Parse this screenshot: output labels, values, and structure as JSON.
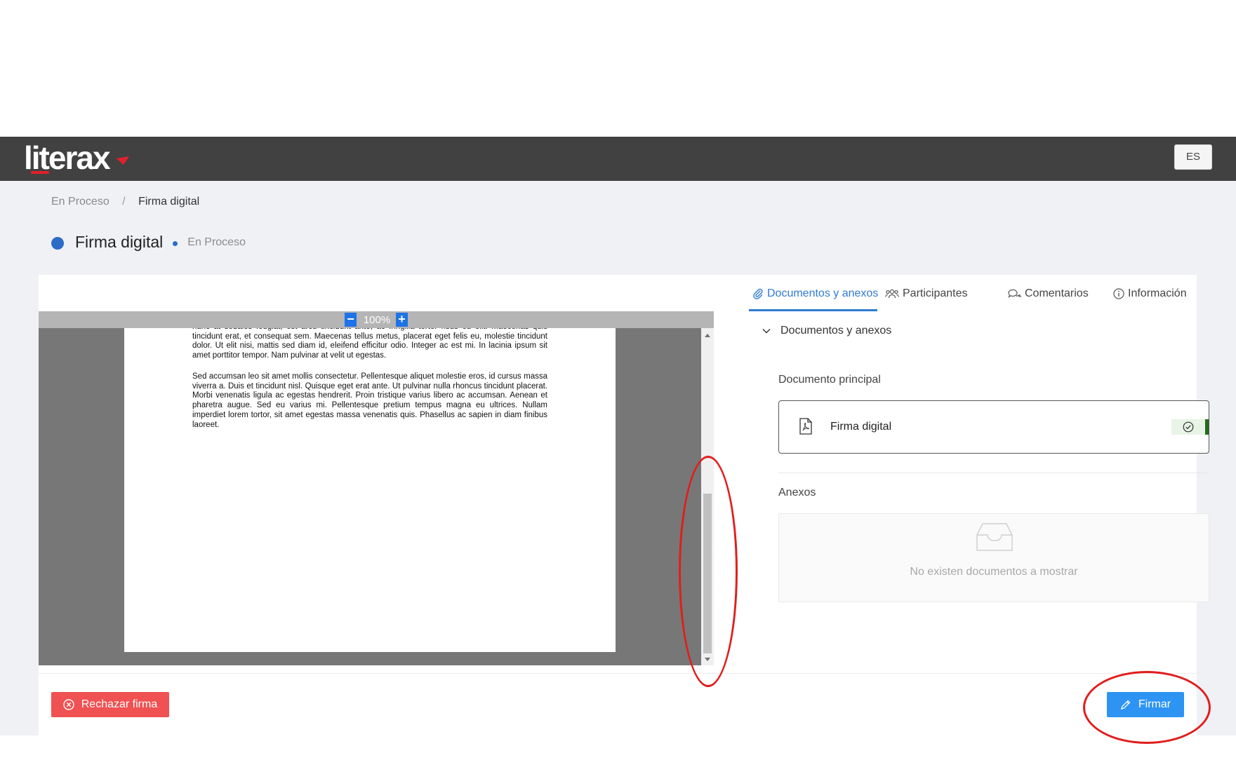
{
  "header": {
    "logo_text": "literax",
    "language_button": "ES"
  },
  "breadcrumb": {
    "items": [
      "En Proceso",
      "Firma digital"
    ],
    "separator": "/"
  },
  "page": {
    "title": "Firma digital",
    "status": "En Proceso",
    "status_color": "#2d6cc7"
  },
  "viewer": {
    "zoom_value": "100%",
    "zoom_out_label": "−",
    "zoom_in_label": "+",
    "paragraphs": [
      "nunc at sodales feugiat, est arcu tincidunt ante, ac fringilla tortor risus eu elit. Maecenas quis tincidunt erat, et consequat sem. Maecenas tellus metus, placerat eget felis eu, molestie tincidunt dolor. Ut elit nisi, mattis sed diam id, eleifend efficitur odio. Integer ac est mi. In lacinia ipsum sit amet porttitor tempor. Nam pulvinar at velit ut egestas.",
      "Sed accumsan leo sit amet mollis consectetur. Pellentesque aliquet molestie eros, id cursus massa viverra a. Duis et tincidunt nisl. Quisque eget erat ante. Ut pulvinar nulla rhoncus tincidunt placerat. Morbi venenatis ligula ac egestas hendrerit. Proin tristique varius libero ac accumsan. Aenean et pharetra augue. Sed eu varius mi. Pellentesque pretium tempus magna eu ultrices. Nullam imperdiet lorem tortor, sit amet egestas massa venenatis quis. Phasellus ac sapien in diam finibus laoreet."
    ]
  },
  "tabs": [
    {
      "label": "Documentos y anexos",
      "icon": "paperclip-icon",
      "active": true
    },
    {
      "label": "Participantes",
      "icon": "users-icon",
      "active": false
    },
    {
      "label": "Comentarios",
      "icon": "comments-icon",
      "active": false
    },
    {
      "label": "Información",
      "icon": "info-icon",
      "active": false
    }
  ],
  "documents_panel": {
    "section_title": "Documentos y anexos",
    "main_document_label": "Documento principal",
    "main_document_name": "Firma digital",
    "main_document_status": "signed-check",
    "annexes_label": "Anexos",
    "annexes_empty_text": "No existen documentos a mostrar"
  },
  "actions": {
    "reject_label": "Rechazar firma",
    "sign_label": "Firmar",
    "reject_color": "#f05152",
    "sign_color": "#2d94f3"
  },
  "colors": {
    "navbar": "#414141",
    "accent": "#2f7bd5",
    "brand_red": "#e3202b",
    "annotation_red": "#e11d1d"
  }
}
